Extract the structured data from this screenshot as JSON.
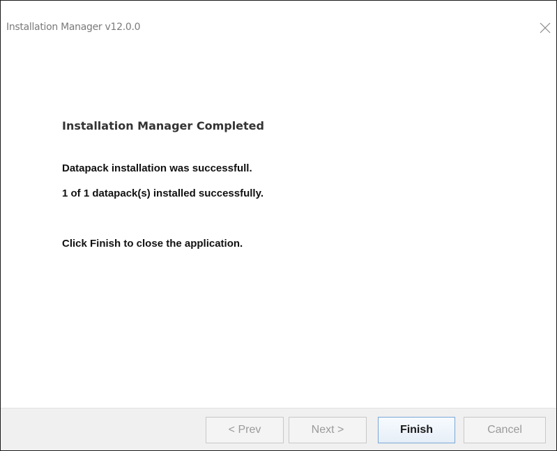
{
  "window": {
    "title": "Installation Manager v12.0.0"
  },
  "main": {
    "heading": "Installation Manager Completed",
    "status_line_1": "Datapack installation was successfull.",
    "status_line_2": "1 of 1 datapack(s) installed successfully.",
    "instruction": "Click Finish to close the application."
  },
  "footer": {
    "prev_label": "< Prev",
    "next_label": "Next >",
    "finish_label": "Finish",
    "cancel_label": "Cancel",
    "prev_enabled": false,
    "next_enabled": false,
    "finish_enabled": true,
    "cancel_enabled": false
  },
  "icons": {
    "close": "close-icon"
  },
  "colors": {
    "background": "#ffffff",
    "footer_background": "#f0f0f0",
    "title_text": "#7a7a7a",
    "heading_text": "#333333",
    "body_text": "#111111",
    "disabled_button_text": "#9a9a9a",
    "primary_button_border": "#7aa7d6"
  }
}
